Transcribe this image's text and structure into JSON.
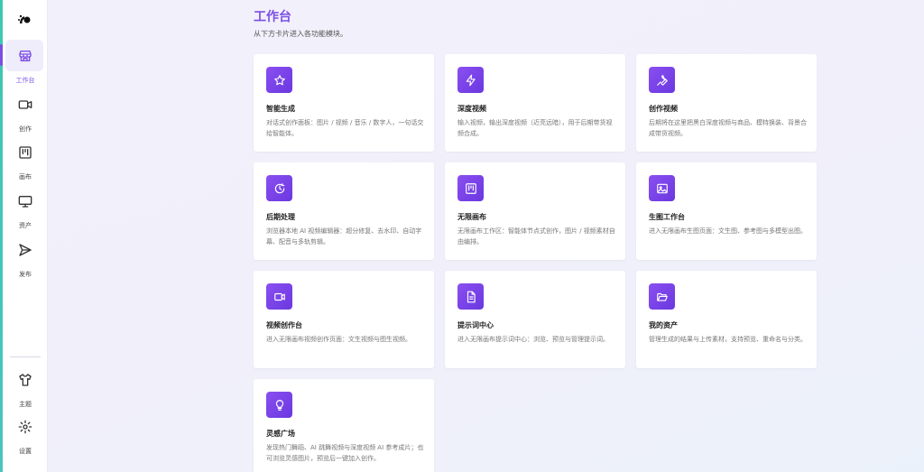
{
  "sidebar": {
    "items": [
      {
        "label": "工作台",
        "icon": "store-icon"
      },
      {
        "label": "创作",
        "icon": "video-camera-icon"
      },
      {
        "label": "画布",
        "icon": "kanban-icon"
      },
      {
        "label": "资产",
        "icon": "monitor-icon"
      },
      {
        "label": "发布",
        "icon": "send-icon"
      }
    ],
    "bottom_items": [
      {
        "label": "主题",
        "icon": "shirt-icon"
      },
      {
        "label": "设置",
        "icon": "gear-icon"
      }
    ],
    "accent_color": "#7b4ee6"
  },
  "page": {
    "title": "工作台",
    "subtitle": "从下方卡片进入各功能模块。"
  },
  "cards": [
    {
      "title": "智能生成",
      "desc": "对话式创作面板：图片 / 视频 / 音乐 / 数字人，一句话交给智能体。",
      "icon": "star-icon"
    },
    {
      "title": "深度视频",
      "desc": "输入视频，输出深度视频（近亮远暗），用于后期带货视频合成。",
      "icon": "lightning-icon"
    },
    {
      "title": "创作视频",
      "desc": "后期将在这里把黑白深度视频与商品、模特换装、背景合成带货视频。",
      "icon": "wrench-icon"
    },
    {
      "title": "后期处理",
      "desc": "浏览器本地 AI 视频编辑器：超分修复、去水印、自动字幕、配音与多轨剪辑。",
      "icon": "clock-icon"
    },
    {
      "title": "无限画布",
      "desc": "无限画布工作区：智能体节点式创作，图片 / 视频素材自由编排。",
      "icon": "kanban-icon"
    },
    {
      "title": "生图工作台",
      "desc": "进入无限画布生图页面：文生图、参考图与多模型出图。",
      "icon": "image-icon"
    },
    {
      "title": "视频创作台",
      "desc": "进入无限画布视频创作页面：文生视频与图生视频。",
      "icon": "video-icon"
    },
    {
      "title": "提示词中心",
      "desc": "进入无限画布提示词中心：浏览、预览与管理提示词。",
      "icon": "document-icon"
    },
    {
      "title": "我的资产",
      "desc": "管理生成的结果与上传素材，支持预览、重命名与分类。",
      "icon": "folder-open-icon"
    },
    {
      "title": "灵感广场",
      "desc": "发现热门舞蹈、AI 跳舞视频与深度视频 AI 参考成片；也可浏览灵感图片，预览后一键加入创作。",
      "icon": "lightbulb-icon"
    }
  ]
}
